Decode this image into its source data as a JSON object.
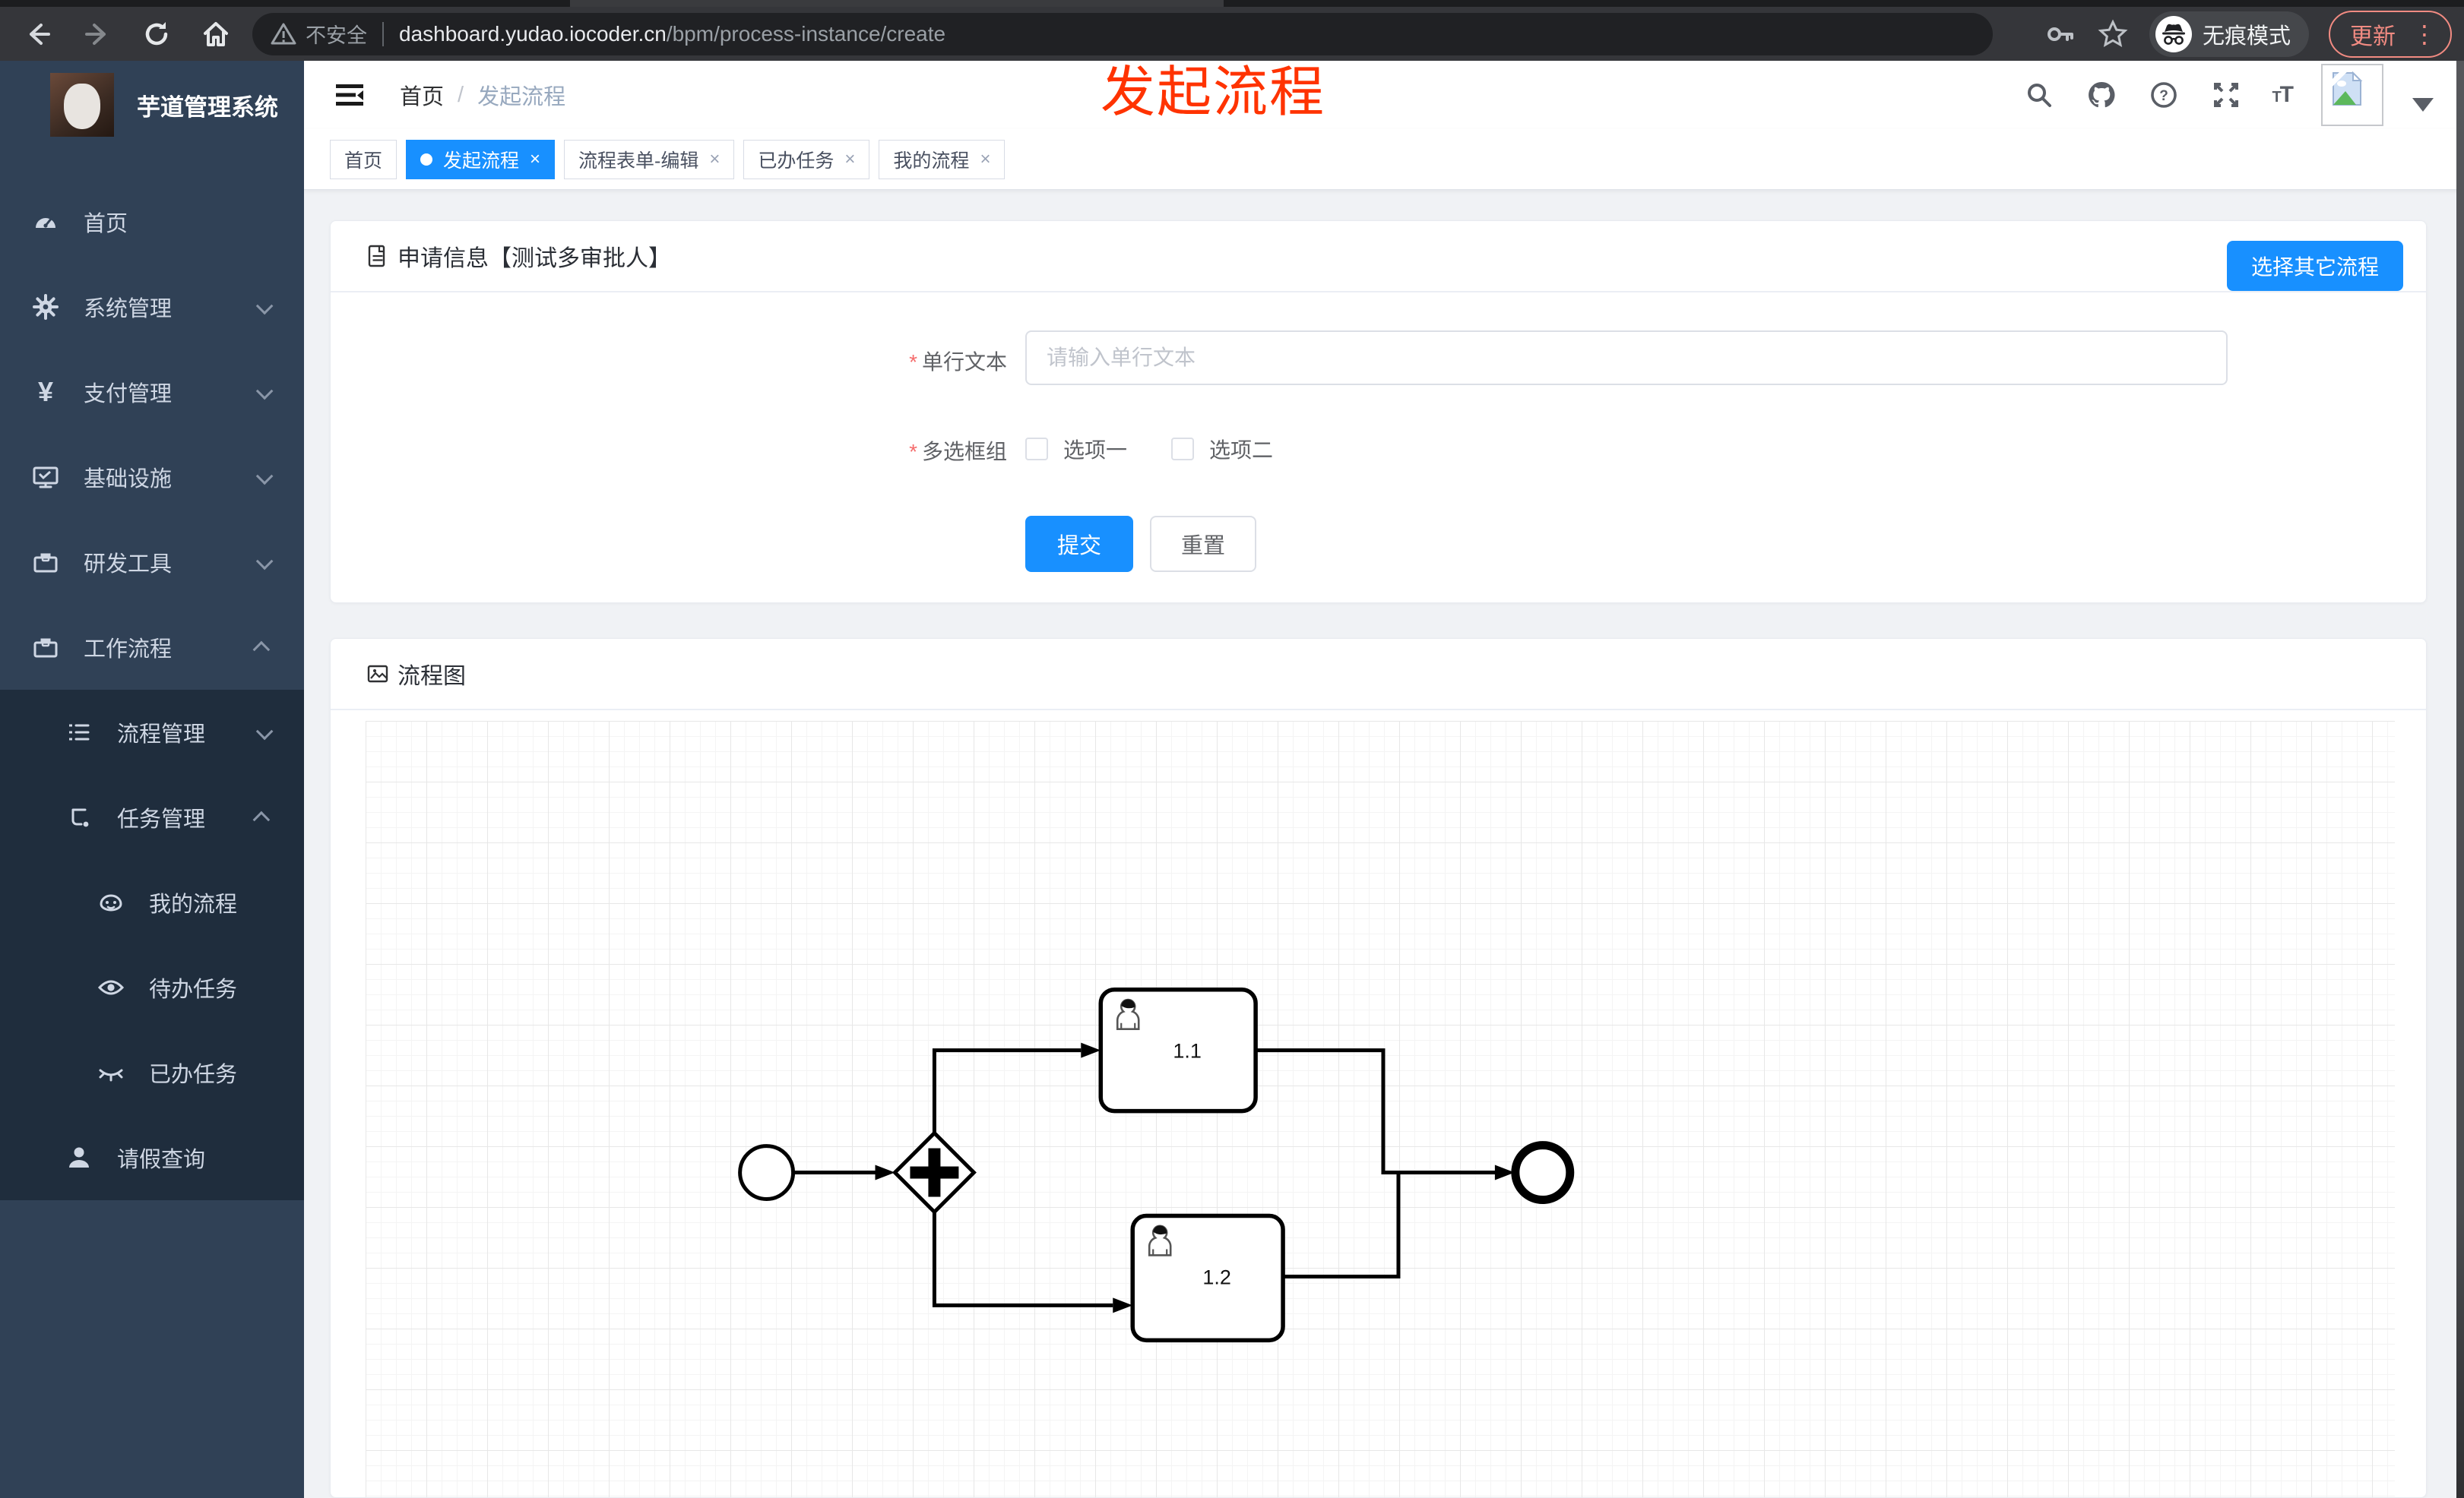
{
  "browser": {
    "security_label": "不安全",
    "url_host": "dashboard.yudao.iocoder.cn",
    "url_path": "/bpm/process-instance/create",
    "incognito_label": "无痕模式",
    "update_label": "更新"
  },
  "annotation": {
    "text": "发起流程"
  },
  "sidebar": {
    "app_title": "芋道管理系统",
    "items": [
      {
        "label": "首页"
      },
      {
        "label": "系统管理"
      },
      {
        "label": "支付管理"
      },
      {
        "label": "基础设施"
      },
      {
        "label": "研发工具"
      },
      {
        "label": "工作流程"
      }
    ],
    "workflow_children": [
      {
        "label": "流程管理"
      },
      {
        "label": "任务管理"
      },
      {
        "label": "我的流程"
      },
      {
        "label": "待办任务"
      },
      {
        "label": "已办任务"
      },
      {
        "label": "请假查询"
      }
    ]
  },
  "header": {
    "breadcrumb_home": "首页",
    "breadcrumb_separator": "/",
    "breadcrumb_current": "发起流程"
  },
  "tabs": [
    {
      "label": "首页"
    },
    {
      "label": "发起流程"
    },
    {
      "label": "流程表单-编辑"
    },
    {
      "label": "已办任务"
    },
    {
      "label": "我的流程"
    }
  ],
  "apply_card": {
    "title": "申请信息【测试多审批人】",
    "select_other_button": "选择其它流程",
    "text_field": {
      "label": "单行文本",
      "placeholder": "请输入单行文本",
      "required_mark": "*"
    },
    "checkbox_group": {
      "label": "多选框组",
      "required_mark": "*",
      "option1": "选项一",
      "option2": "选项二"
    },
    "submit_label": "提交",
    "reset_label": "重置"
  },
  "flow_card": {
    "title": "流程图",
    "nodes": {
      "task1": "1.1",
      "task2": "1.2"
    }
  },
  "icons": {
    "close": "×",
    "question": "?",
    "dots_vertical": "⋮",
    "yen": "¥"
  },
  "colors": {
    "primary": "#1890ff",
    "sidebar_bg": "#304156",
    "submenu_bg": "#1f2d3d",
    "annotation_red": "#ff3300",
    "chrome_bg": "#35363a",
    "update_coral": "#f28b82"
  }
}
